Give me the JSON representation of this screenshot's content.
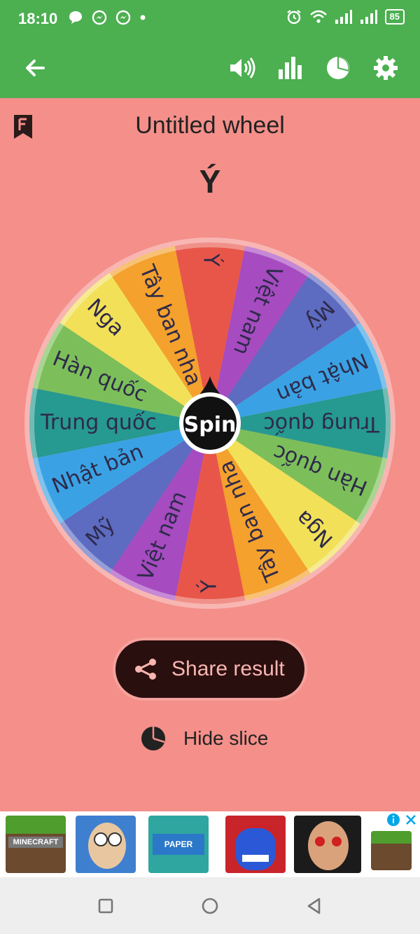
{
  "status": {
    "time": "18:10",
    "battery": "85"
  },
  "toolbar": {
    "icons": [
      "back-arrow-icon",
      "volume-icon",
      "bar-chart-icon",
      "pie-chart-icon",
      "settings-gear-icon"
    ]
  },
  "wheel": {
    "title": "Untitled wheel",
    "result": "Ý",
    "spin_label": "Spin",
    "slices": [
      "Ý",
      "Việt nam",
      "Mỹ",
      "Nhật bản",
      "Trung quốc",
      "Hàn quốc",
      "Nga",
      "Tây ban nha",
      "Ý",
      "Việt nam",
      "Mỹ",
      "Nhật bản",
      "Trung quốc",
      "Hàn quốc",
      "Nga",
      "Tây ban nha"
    ],
    "slice_colors": [
      "#e8564a",
      "#a64bc0",
      "#5d6bc1",
      "#3aa2e4",
      "#269990",
      "#7cbf5a",
      "#f2e158",
      "#f4a12d",
      "#e8564a",
      "#a64bc0",
      "#5d6bc1",
      "#3aa2e4",
      "#269990",
      "#7cbf5a",
      "#f2e158",
      "#f4a12d"
    ],
    "text_color": "#2e2a4a"
  },
  "actions": {
    "share_label": "Share result",
    "hide_slice_label": "Hide slice"
  },
  "ad": {
    "tiles": [
      "minecraft-thumbnail",
      "cartoon-face-thumbnail",
      "minecraft-paper-thumbnail",
      "blue-monster-thumbnail",
      "baby-face-thumbnail",
      "minecraft-thumbnail"
    ]
  },
  "colors": {
    "app_bar": "#4caf50",
    "background": "#f48f8a",
    "button_bg": "#2a0f0f"
  }
}
